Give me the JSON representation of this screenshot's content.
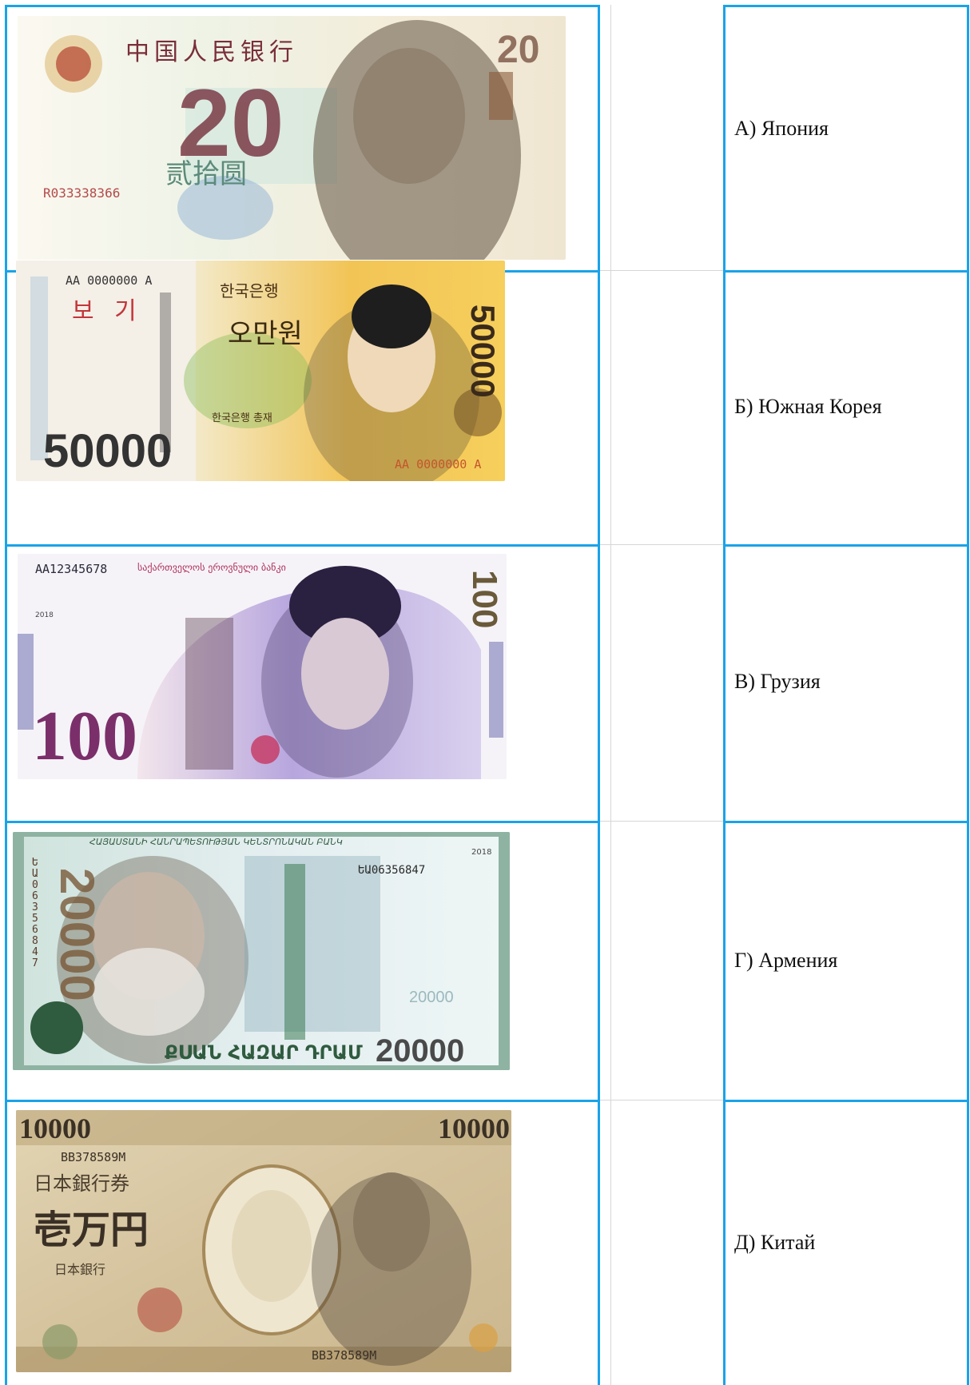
{
  "colors": {
    "table_border": "#1aa3e8",
    "inner_divider": "#d6d6d6"
  },
  "rows": [
    {
      "banknote": {
        "country": "China",
        "denomination": "20",
        "bank_text": "中国人民银行",
        "amount_text": "贰拾圆",
        "serial": "R033338366",
        "palette": [
          "#f7f3ea",
          "#7a2e3a",
          "#5a4a3a",
          "#b6d7c8"
        ]
      },
      "answer": "А) Япония"
    },
    {
      "banknote": {
        "country": "South Korea",
        "denomination": "50000",
        "serial": "AA 0000000 A",
        "specimen_text": "보 기",
        "bank_text": "한국은행",
        "amount_text": "오만원",
        "governor_text": "한국은행 총재",
        "serial_bottom": "AA 0000000 A",
        "palette": [
          "#f3c64b",
          "#e59a2a",
          "#ffffff",
          "#2b2b2b"
        ]
      },
      "answer": "Б) Южная Корея"
    },
    {
      "banknote": {
        "country": "Georgia",
        "denomination": "100",
        "serial": "AA12345678",
        "bank_text": "საქართველოს ეროვნული ბანკი",
        "year": "2018",
        "palette": [
          "#a690d8",
          "#d23a6b",
          "#3b2b4b",
          "#e9e3f2"
        ]
      },
      "answer": "В) Грузия"
    },
    {
      "banknote": {
        "country": "Armenia",
        "denomination": "20000",
        "bank_text": "ՀԱՅԱՍՏԱՆԻ ՀԱՆՐԱՊԵՏՈՒԹՅԱՆ ԿԵՆՏՐՈՆԱԿԱՆ ԲԱՆԿ",
        "serial": "ԵԱ06356847",
        "vertical_serial": "ԵԱ06356847",
        "amount_text": "ՔՍԱՆ ՀԱԶԱՐ ԴՐԱՄ",
        "watermark": "20000",
        "year": "2018",
        "palette": [
          "#dff0ea",
          "#3a8a5a",
          "#6c5a4a",
          "#b8d6e0"
        ]
      },
      "answer": "Г) Армения"
    },
    {
      "banknote": {
        "country": "Japan",
        "denomination": "10000",
        "serial": "BB378589M",
        "bank_text": "日本銀行券",
        "amount_text": "壱万円",
        "issuer_text": "日本銀行",
        "palette": [
          "#d9c9a6",
          "#6b5a3e",
          "#a6824a",
          "#3a3025"
        ]
      },
      "answer": "Д) Китай"
    }
  ]
}
